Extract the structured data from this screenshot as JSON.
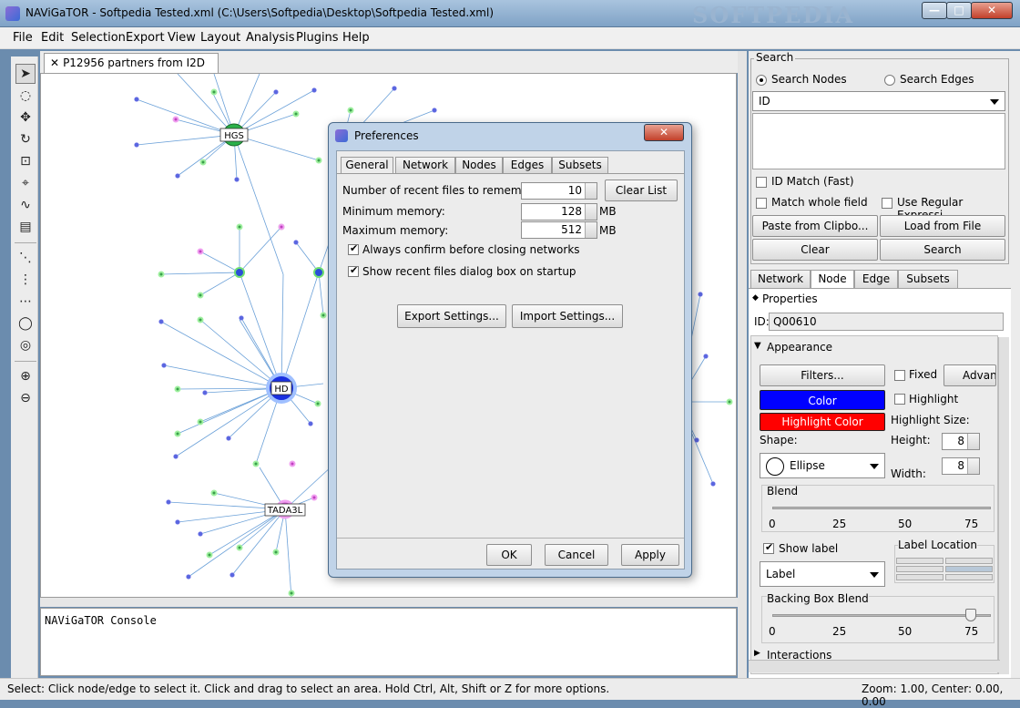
{
  "window": {
    "title": "NAViGaTOR - Softpedia Tested.xml (C:\\Users\\Softpedia\\Desktop\\Softpedia Tested.xml)",
    "minimize": "—",
    "maximize": "□",
    "close": "✕"
  },
  "menu": [
    "File",
    "Edit",
    "Selection",
    "Export",
    "View",
    "Layout",
    "Analysis",
    "Plugins",
    "Help"
  ],
  "graph_tab": {
    "close": "✕",
    "label": "P12956 partners from I2D"
  },
  "graph_nodes": {
    "hgs": "HGS",
    "hd": "HD",
    "tada3l": "TADA3L"
  },
  "console": {
    "text": "NAViGaTOR Console"
  },
  "status": {
    "left": "Select: Click node/edge to select it. Click and drag to select an area. Hold Ctrl, Alt, Shift or Z for more options.",
    "right": "Zoom: 1.00, Center: 0.00, 0.00"
  },
  "search": {
    "title": "Search",
    "search_nodes": "Search Nodes",
    "search_edges": "Search Edges",
    "field_select": "ID",
    "id_match": "ID Match (Fast)",
    "match_whole": "Match whole field",
    "use_regex": "Use Regular Expressi...",
    "paste": "Paste from Clipbo...",
    "load": "Load from File",
    "clear": "Clear",
    "search_btn": "Search"
  },
  "panel_tabs": [
    "Network",
    "Node",
    "Edge",
    "Subsets"
  ],
  "properties": {
    "title": "Properties",
    "id_label": "ID:",
    "id_value": "Q00610"
  },
  "appearance": {
    "title": "Appearance",
    "filters": "Filters...",
    "fixed": "Fixed",
    "advanced": "Advan",
    "color": "Color",
    "color_hex": "#0000ff",
    "highlight": "Highlight",
    "highlight_color": "Highlight Color",
    "highlight_color_hex": "#ff0000",
    "highlight_size": "Highlight Size:",
    "shape_label": "Shape:",
    "height_label": "Height:",
    "height_value": "8",
    "width_label": "Width:",
    "width_value": "8",
    "shape_value": "Ellipse",
    "blend": "Blend",
    "blend_ticks": [
      "0",
      "25",
      "50",
      "75"
    ],
    "show_label": "Show label",
    "label_location": "Label Location",
    "label_combo": "Label",
    "backing_box_blend": "Backing Box Blend",
    "backing_ticks": [
      "0",
      "25",
      "50",
      "75"
    ],
    "interactions": "Interactions"
  },
  "dialog": {
    "title": "Preferences",
    "close": "✕",
    "tabs": [
      "General",
      "Network",
      "Nodes",
      "Edges",
      "Subsets"
    ],
    "recent_files_label": "Number of recent files to remember:",
    "recent_files_value": "10",
    "clear_list": "Clear List",
    "min_mem_label": "Minimum memory:",
    "min_mem_value": "128",
    "max_mem_label": "Maximum memory:",
    "max_mem_value": "512",
    "mb": "MB",
    "always_confirm": "Always confirm before closing networks",
    "show_recent": "Show recent files dialog box on startup",
    "export_settings": "Export Settings...",
    "import_settings": "Import Settings...",
    "ok": "OK",
    "cancel": "Cancel",
    "apply": "Apply"
  }
}
